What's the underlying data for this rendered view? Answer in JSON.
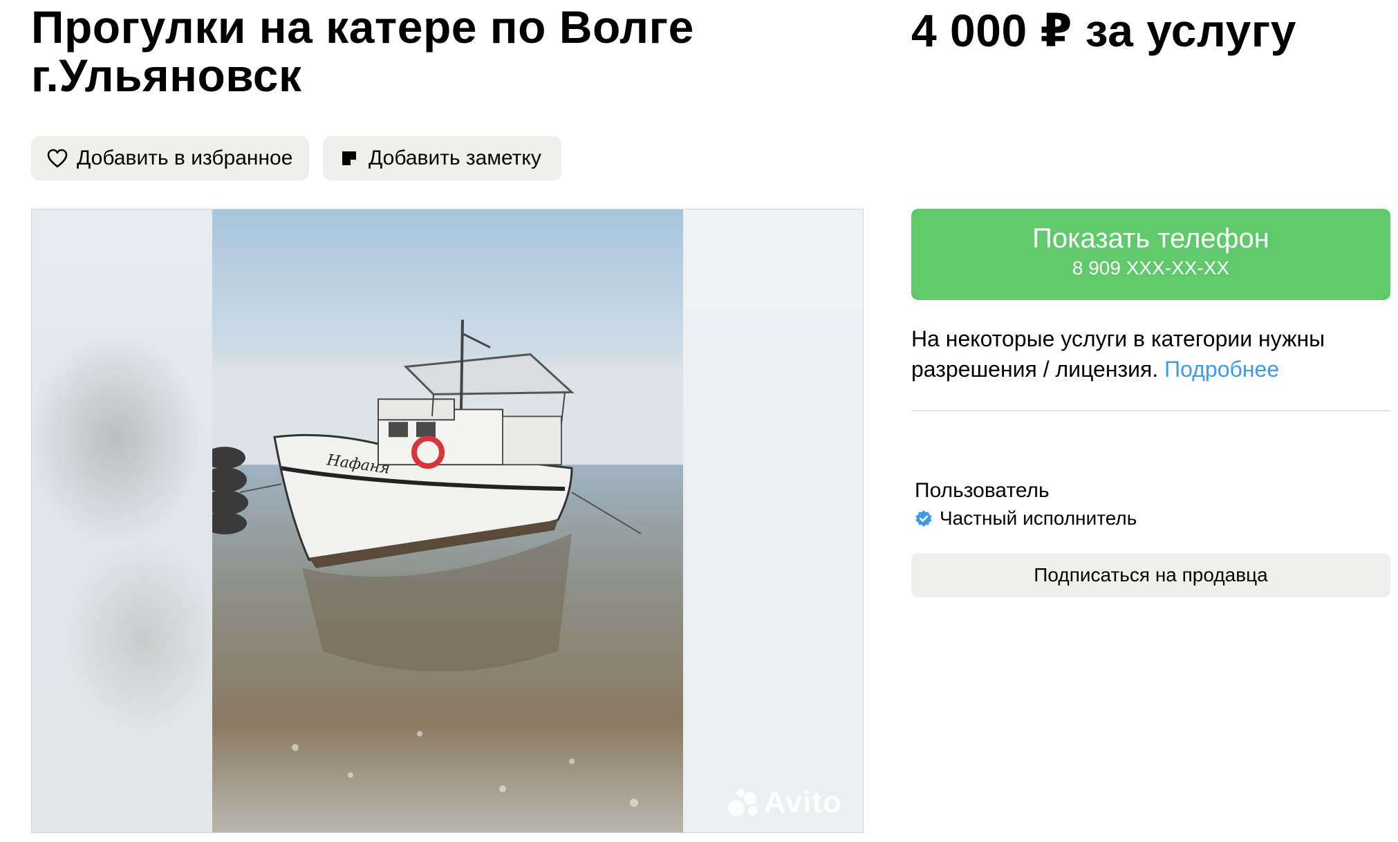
{
  "listing": {
    "title": "Прогулки на катере по Волге г.Ульяновск",
    "price": "4 000 ₽ за услугу"
  },
  "actions": {
    "favorite_label": "Добавить в избранное",
    "note_label": "Добавить заметку"
  },
  "gallery": {
    "photo_boat_name": "Нафаня",
    "watermark": "Avito",
    "icons": [
      "heart-icon",
      "note-icon"
    ]
  },
  "contact": {
    "show_phone_label": "Показать телефон",
    "phone_masked": "8 909 XXX-XX-XX"
  },
  "notice": {
    "text": "На некоторые услуги в категории нужны разрешения / лицензия. ",
    "link": "Подробнее"
  },
  "seller": {
    "name": "Пользователь",
    "type": "Частный исполнитель",
    "subscribe_label": "Подписаться на продавца"
  },
  "colors": {
    "accent_green": "#5fc96c",
    "link_blue": "#3d9be9",
    "pill_bg": "#efefed"
  }
}
